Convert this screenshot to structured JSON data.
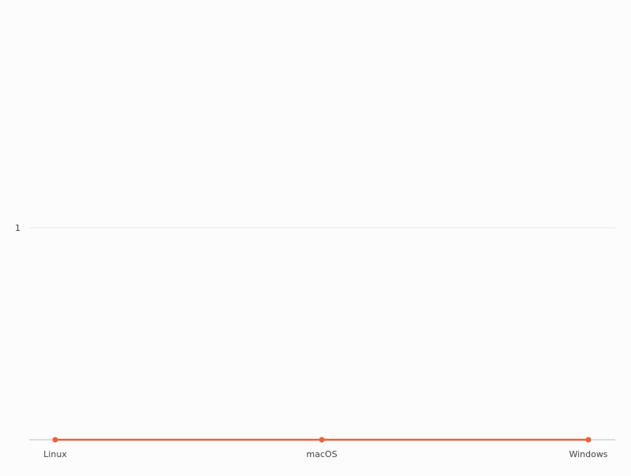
{
  "chart_data": {
    "type": "line",
    "categories": [
      "Linux",
      "macOS",
      "Windows"
    ],
    "series": [
      {
        "values": [
          0,
          0,
          0
        ]
      }
    ],
    "ylim": [
      0,
      1
    ],
    "yticks": [
      1
    ],
    "grid": true,
    "colors": {
      "line": "#e8643a",
      "grid": "#e6e6e6",
      "axis": "#bdbdbd",
      "text": "#444444"
    }
  }
}
